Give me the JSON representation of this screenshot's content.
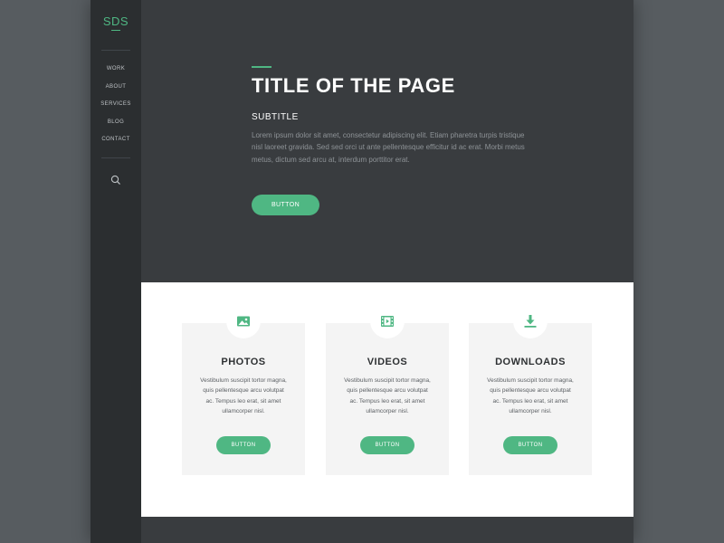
{
  "sidebar": {
    "logo": "SDS",
    "nav_items": [
      "WORK",
      "ABOUT",
      "SERVICES",
      "BLOG",
      "CONTACT"
    ],
    "search_icon": "search-icon"
  },
  "hero": {
    "title": "TITLE OF THE PAGE",
    "subtitle": "SUBTITLE",
    "body": "Lorem ipsum dolor sit amet, consectetur adipiscing elit. Etiam pharetra turpis tristique nisl laoreet gravida. Sed sed orci ut ante pellentesque efficitur id ac erat. Morbi metus metus, dictum sed arcu at, interdum porttitor erat.",
    "button_label": "BUTTON"
  },
  "features": [
    {
      "icon": "image-icon",
      "title": "PHOTOS",
      "text": "Vestibulum suscipit tortor magna, quis pellentesque arcu volutpat ac. Tempus leo erat, sit amet ullamcorper nisl.",
      "button_label": "BUTTON"
    },
    {
      "icon": "film-icon",
      "title": "VIDEOS",
      "text": "Vestibulum suscipit tortor magna, quis pellentesque arcu volutpat ac. Tempus leo erat, sit amet ullamcorper nisl.",
      "button_label": "BUTTON"
    },
    {
      "icon": "download-icon",
      "title": "DOWNLOADS",
      "text": "Vestibulum suscipit tortor magna, quis pellentesque arcu volutpat ac. Tempus leo erat, sit amet ullamcorper nisl.",
      "button_label": "BUTTON"
    }
  ],
  "colors": {
    "accent": "#4fb783",
    "hero_background": "#393c3f",
    "sidebar_background": "#2b2e30",
    "outer_background": "#575c60",
    "card_background": "#f4f4f4"
  }
}
